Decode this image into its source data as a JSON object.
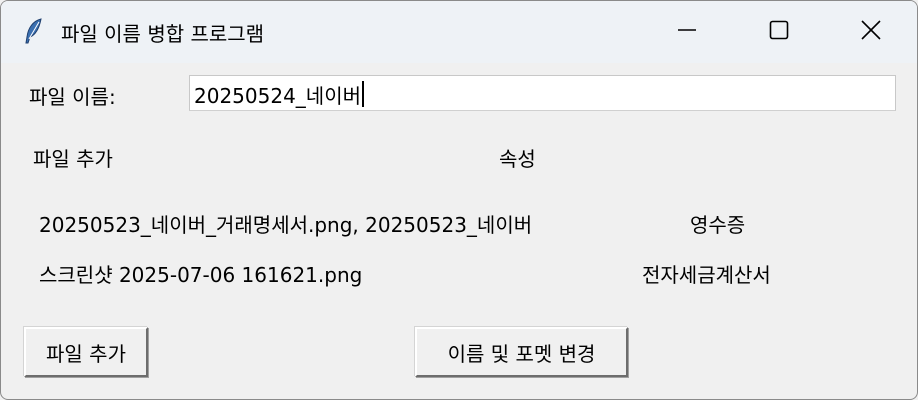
{
  "window": {
    "title": "파일 이름 병합 프로그램",
    "icons": {
      "app": "feather-icon",
      "minimize": "minimize-icon",
      "maximize": "maximize-icon",
      "close": "close-icon"
    }
  },
  "form": {
    "filename_label": "파일 이름:",
    "filename_value": "20250524_네이버"
  },
  "headers": {
    "files": "파일 추가",
    "attribute": "속성"
  },
  "rows": [
    {
      "files": "20250523_네이버_거래명세서.png, 20250523_네이버",
      "attribute": "영수증"
    },
    {
      "files": "스크린샷 2025-07-06 161621.png",
      "attribute": "전자세금계산서"
    }
  ],
  "buttons": {
    "add_file": "파일 추가",
    "rename_format": "이름 및 포멧 변경"
  },
  "colors": {
    "background": "#f0f0f0",
    "titlebar": "#eef2f6",
    "input_bg": "#ffffff"
  }
}
